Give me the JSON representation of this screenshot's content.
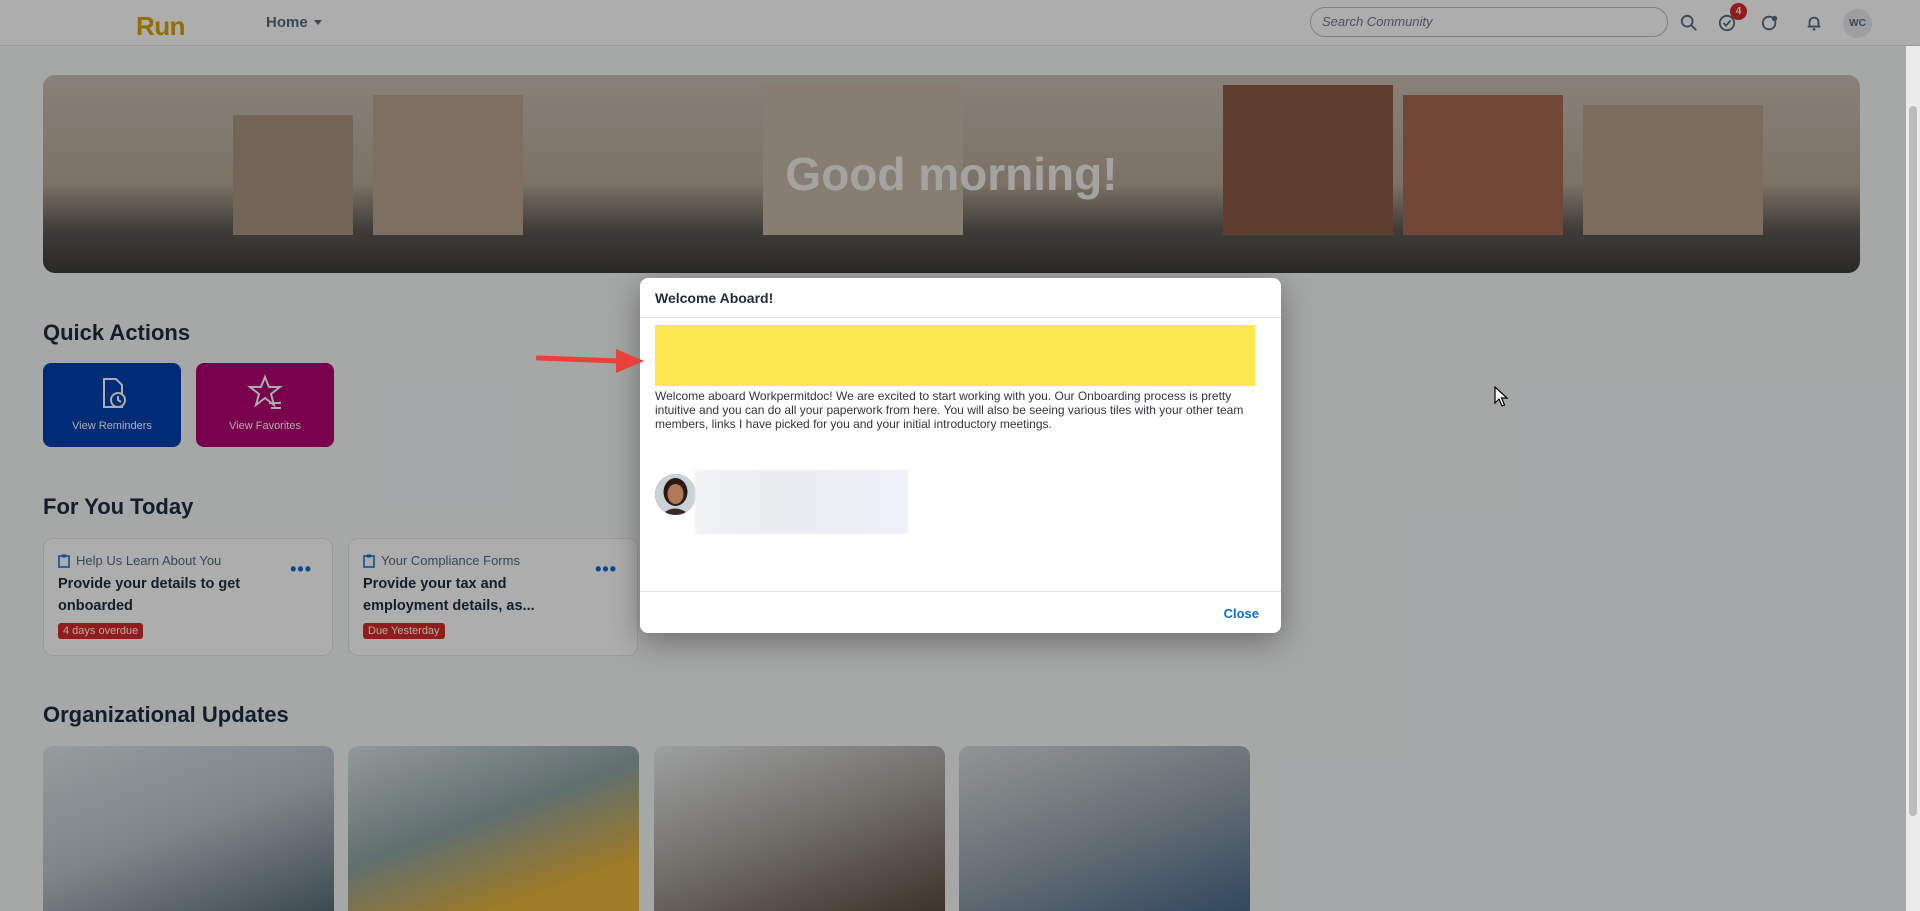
{
  "header": {
    "logo": "Run",
    "home_label": "Home",
    "search_placeholder": "Search Community",
    "tasks_badge": "4",
    "user_initials": "WC"
  },
  "hero": {
    "greeting": "Good morning!"
  },
  "quick_actions": {
    "title": "Quick Actions",
    "items": [
      {
        "label": "View Reminders",
        "icon": "reminder-clock-icon",
        "color": "#0040b0"
      },
      {
        "label": "View Favorites",
        "icon": "favorites-star-icon",
        "color": "#b30070"
      }
    ]
  },
  "for_you_today": {
    "title": "For You Today",
    "cards": [
      {
        "category": "Help Us Learn About You",
        "title": "Provide your details to get onboarded",
        "status": "4 days overdue"
      },
      {
        "category": "Your Compliance Forms",
        "title": "Provide your tax and employment details, as...",
        "status": "Due Yesterday"
      }
    ]
  },
  "org_updates": {
    "title": "Organizational Updates"
  },
  "dialog": {
    "title": "Welcome Aboard!",
    "message": "Welcome aboard Workpermitdoc! We are excited to start working with you. Our Onboarding process is pretty intuitive and you can do all your paperwork from here. You will also be seeing various tiles with your other team members, links I have picked for you and your initial introductory meetings.",
    "close_label": "Close",
    "highlight_color": "#fde84f"
  }
}
